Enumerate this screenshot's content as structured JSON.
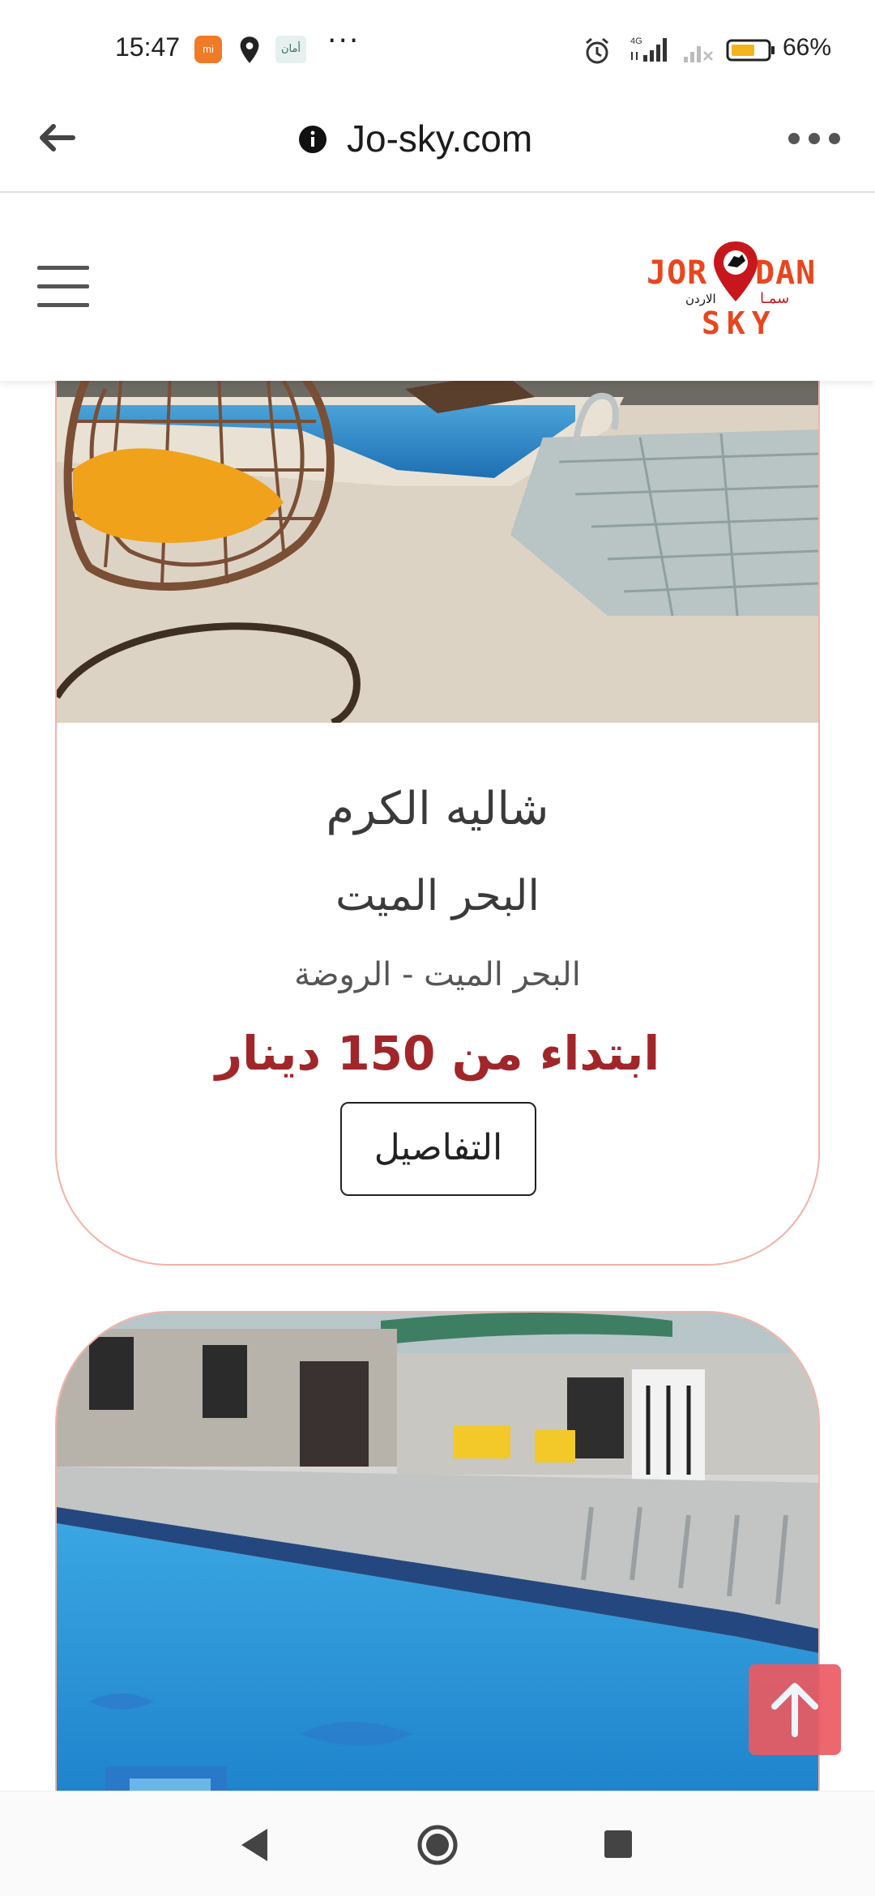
{
  "status_bar": {
    "time": "15:47",
    "mi_badge": "mi",
    "aman_badge": "أمان",
    "more": "···",
    "network": "4G",
    "battery_percent": "66%",
    "icons": [
      "mi-app-icon",
      "location-icon",
      "aman-app-icon",
      "alarm-icon",
      "signal-icon",
      "no-signal-icon",
      "battery-icon"
    ]
  },
  "browser": {
    "url": "Jo-sky.com",
    "icons": [
      "back-arrow-icon",
      "info-icon",
      "more-menu-icon"
    ]
  },
  "header": {
    "logo_top": "JORDAN",
    "logo_arabic": "سمـا الاردن",
    "logo_bottom": "SKY",
    "icons": [
      "hamburger-menu-icon",
      "map-pin-icon"
    ],
    "brand_colors": {
      "orange": "#e8461f",
      "red": "#c8161d"
    }
  },
  "listing": {
    "title": "شاليه الكرم",
    "region": "البحر الميت",
    "location": "البحر الميت - الروضة",
    "price": "ابتداء من 150 دينار",
    "details_button": "التفاصيل",
    "price_color": "#a1262a",
    "border_color": "#f2b2a6"
  },
  "scroll_to_top": {
    "icon": "arrow-up-icon",
    "color": "#ea5a62"
  },
  "nav_bar": {
    "icons": [
      "nav-back-icon",
      "nav-home-icon",
      "nav-recents-icon"
    ]
  }
}
